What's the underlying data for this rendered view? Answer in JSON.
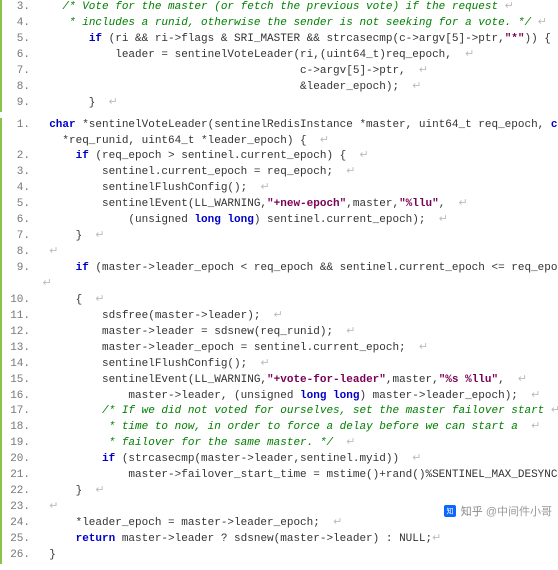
{
  "block1": {
    "lines": [
      {
        "n": "3.",
        "segs": [
          {
            "t": "    ",
            "k": ""
          },
          {
            "t": "/* Vote for the master (or fetch the previous vote) if the request",
            "k": "c-comment"
          },
          {
            "t": " ↵",
            "k": "nl"
          }
        ]
      },
      {
        "n": "4.",
        "segs": [
          {
            "t": "     ",
            "k": ""
          },
          {
            "t": "* includes a runid, otherwise the sender is not seeking for a vote. */",
            "k": "c-comment"
          },
          {
            "t": " ↵",
            "k": "nl"
          }
        ]
      },
      {
        "n": "5.",
        "segs": [
          {
            "t": "        ",
            "k": ""
          },
          {
            "t": "if",
            "k": "c-kw"
          },
          {
            "t": " (ri && ri->flags & SRI_MASTER && strcasecmp(c->argv[5]->ptr,",
            "k": ""
          },
          {
            "t": "\"*\"",
            "k": "c-str"
          },
          {
            "t": ")) {  ",
            "k": ""
          },
          {
            "t": "↵",
            "k": "nl"
          }
        ]
      },
      {
        "n": "6.",
        "segs": [
          {
            "t": "            leader = sentinelVoteLeader(ri,(uint64_t)req_epoch,  ",
            "k": ""
          },
          {
            "t": "↵",
            "k": "nl"
          }
        ]
      },
      {
        "n": "7.",
        "segs": [
          {
            "t": "                                        c->argv[5]->ptr,  ",
            "k": ""
          },
          {
            "t": "↵",
            "k": "nl"
          }
        ]
      },
      {
        "n": "8.",
        "segs": [
          {
            "t": "                                        &leader_epoch);  ",
            "k": ""
          },
          {
            "t": "↵",
            "k": "nl"
          }
        ]
      },
      {
        "n": "9.",
        "segs": [
          {
            "t": "        }  ",
            "k": ""
          },
          {
            "t": "↵",
            "k": "nl"
          }
        ]
      }
    ]
  },
  "block2": {
    "lines": [
      {
        "n": "1.",
        "segs": [
          {
            "t": "  ",
            "k": ""
          },
          {
            "t": "char",
            "k": "c-type"
          },
          {
            "t": " *sentinelVoteLeader(sentinelRedisInstance *master, uint64_t req_epoch, ",
            "k": ""
          },
          {
            "t": "char",
            "k": "c-type"
          }
        ]
      },
      {
        "n": "",
        "segs": [
          {
            "t": "    *req_runid, uint64_t *leader_epoch) {  ",
            "k": ""
          },
          {
            "t": "↵",
            "k": "nl"
          }
        ]
      },
      {
        "n": "2.",
        "segs": [
          {
            "t": "      ",
            "k": ""
          },
          {
            "t": "if",
            "k": "c-kw"
          },
          {
            "t": " (req_epoch > sentinel.current_epoch) {  ",
            "k": ""
          },
          {
            "t": "↵",
            "k": "nl"
          }
        ]
      },
      {
        "n": "3.",
        "segs": [
          {
            "t": "          sentinel.current_epoch = req_epoch;  ",
            "k": ""
          },
          {
            "t": "↵",
            "k": "nl"
          }
        ]
      },
      {
        "n": "4.",
        "segs": [
          {
            "t": "          sentinelFlushConfig();  ",
            "k": ""
          },
          {
            "t": "↵",
            "k": "nl"
          }
        ]
      },
      {
        "n": "5.",
        "segs": [
          {
            "t": "          sentinelEvent(LL_WARNING,",
            "k": ""
          },
          {
            "t": "\"+new-epoch\"",
            "k": "c-str"
          },
          {
            "t": ",master,",
            "k": ""
          },
          {
            "t": "\"%llu\"",
            "k": "c-str"
          },
          {
            "t": ",  ",
            "k": ""
          },
          {
            "t": "↵",
            "k": "nl"
          }
        ]
      },
      {
        "n": "6.",
        "segs": [
          {
            "t": "              (unsigned ",
            "k": ""
          },
          {
            "t": "long long",
            "k": "c-kw"
          },
          {
            "t": ") sentinel.current_epoch);  ",
            "k": ""
          },
          {
            "t": "↵",
            "k": "nl"
          }
        ]
      },
      {
        "n": "7.",
        "segs": [
          {
            "t": "      }  ",
            "k": ""
          },
          {
            "t": "↵",
            "k": "nl"
          }
        ]
      },
      {
        "n": "8.",
        "segs": [
          {
            "t": "  ",
            "k": ""
          },
          {
            "t": "↵",
            "k": "nl"
          }
        ]
      },
      {
        "n": "9.",
        "segs": [
          {
            "t": "      ",
            "k": ""
          },
          {
            "t": "if",
            "k": "c-kw"
          },
          {
            "t": " (master->leader_epoch < req_epoch && sentinel.current_epoch <= req_epoch)",
            "k": ""
          }
        ]
      },
      {
        "n": "",
        "segs": [
          {
            "t": " ↵",
            "k": "nl"
          }
        ]
      },
      {
        "n": "10.",
        "segs": [
          {
            "t": "      {  ",
            "k": ""
          },
          {
            "t": "↵",
            "k": "nl"
          }
        ]
      },
      {
        "n": "11.",
        "segs": [
          {
            "t": "          sdsfree(master->leader);  ",
            "k": ""
          },
          {
            "t": "↵",
            "k": "nl"
          }
        ]
      },
      {
        "n": "12.",
        "segs": [
          {
            "t": "          master->leader = sdsnew(req_runid);  ",
            "k": ""
          },
          {
            "t": "↵",
            "k": "nl"
          }
        ]
      },
      {
        "n": "13.",
        "segs": [
          {
            "t": "          master->leader_epoch = sentinel.current_epoch;  ",
            "k": ""
          },
          {
            "t": "↵",
            "k": "nl"
          }
        ]
      },
      {
        "n": "14.",
        "segs": [
          {
            "t": "          sentinelFlushConfig();  ",
            "k": ""
          },
          {
            "t": "↵",
            "k": "nl"
          }
        ]
      },
      {
        "n": "15.",
        "segs": [
          {
            "t": "          sentinelEvent(LL_WARNING,",
            "k": ""
          },
          {
            "t": "\"+vote-for-leader\"",
            "k": "c-str"
          },
          {
            "t": ",master,",
            "k": ""
          },
          {
            "t": "\"%s %llu\"",
            "k": "c-str"
          },
          {
            "t": ",  ",
            "k": ""
          },
          {
            "t": "↵",
            "k": "nl"
          }
        ]
      },
      {
        "n": "16.",
        "segs": [
          {
            "t": "              master->leader, (unsigned ",
            "k": ""
          },
          {
            "t": "long long",
            "k": "c-kw"
          },
          {
            "t": ") master->leader_epoch);  ",
            "k": ""
          },
          {
            "t": "↵",
            "k": "nl"
          }
        ]
      },
      {
        "n": "17.",
        "segs": [
          {
            "t": "          ",
            "k": ""
          },
          {
            "t": "/* If we did not voted for ourselves, set the master failover start",
            "k": "c-comment"
          },
          {
            "t": " ↵",
            "k": "nl"
          }
        ]
      },
      {
        "n": "18.",
        "segs": [
          {
            "t": "           ",
            "k": ""
          },
          {
            "t": "* time to now, in order to force a delay before we can start a",
            "k": "c-comment"
          },
          {
            "t": "  ↵",
            "k": "nl"
          }
        ]
      },
      {
        "n": "19.",
        "segs": [
          {
            "t": "           ",
            "k": ""
          },
          {
            "t": "* failover for the same master. */",
            "k": "c-comment"
          },
          {
            "t": "  ",
            "k": ""
          },
          {
            "t": "↵",
            "k": "nl"
          }
        ]
      },
      {
        "n": "20.",
        "segs": [
          {
            "t": "          ",
            "k": ""
          },
          {
            "t": "if",
            "k": "c-kw"
          },
          {
            "t": " (strcasecmp(master->leader,sentinel.myid))  ",
            "k": ""
          },
          {
            "t": "↵",
            "k": "nl"
          }
        ]
      },
      {
        "n": "21.",
        "segs": [
          {
            "t": "              master->failover_start_time = mstime()+rand()%SENTINEL_MAX_DESYNC;",
            "k": ""
          }
        ]
      },
      {
        "n": "22.",
        "segs": [
          {
            "t": "      }  ",
            "k": ""
          },
          {
            "t": "↵",
            "k": "nl"
          }
        ]
      },
      {
        "n": "23.",
        "segs": [
          {
            "t": "  ",
            "k": ""
          },
          {
            "t": "↵",
            "k": "nl"
          }
        ]
      },
      {
        "n": "24.",
        "segs": [
          {
            "t": "      *leader_epoch = master->leader_epoch;  ",
            "k": ""
          },
          {
            "t": "↵",
            "k": "nl"
          }
        ]
      },
      {
        "n": "25.",
        "segs": [
          {
            "t": "      ",
            "k": ""
          },
          {
            "t": "return",
            "k": "c-kw"
          },
          {
            "t": " master->leader ? sdsnew(master->leader) : NULL;",
            "k": ""
          },
          {
            "t": "↵",
            "k": "nl"
          }
        ]
      },
      {
        "n": "26.",
        "segs": [
          {
            "t": "  }",
            "k": ""
          }
        ]
      }
    ]
  },
  "watermark": {
    "brand": "知乎",
    "author": "@中间件小哥"
  }
}
